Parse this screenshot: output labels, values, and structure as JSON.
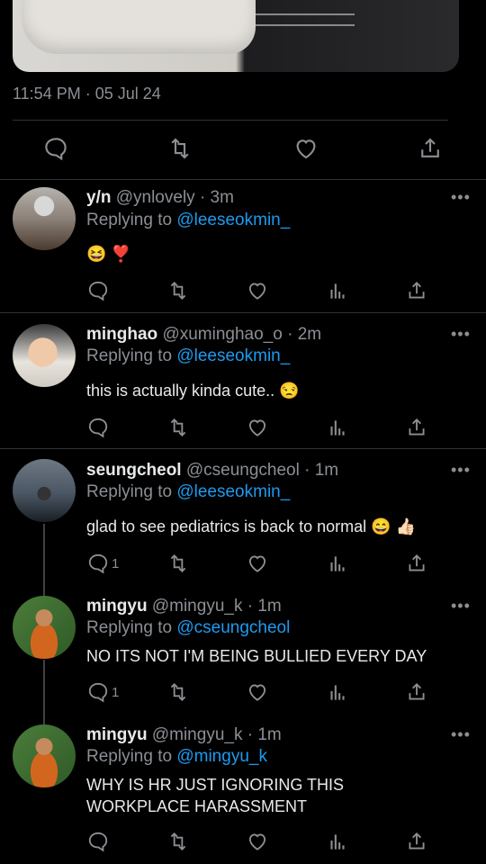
{
  "timestamp": "11:54 PM · 05 Jul 24",
  "colors": {
    "background": "#000000",
    "text": "#e7e9ea",
    "muted": "#8b8f94",
    "link": "#1d9bf0",
    "divider": "#2f3336"
  },
  "main_actions": [
    "reply-icon",
    "retweet-icon",
    "like-icon",
    "share-icon"
  ],
  "replies": [
    {
      "name": "y/n",
      "handle": "@ynlovely",
      "time": "· 3m",
      "replying_prefix": "Replying to",
      "replying_to": "@leeseokmin_",
      "text": "😆 ❣️",
      "reply_count": ""
    },
    {
      "name": "minghao",
      "handle": "@xuminghao_o",
      "time": "· 2m",
      "replying_prefix": "Replying to",
      "replying_to": "@leeseokmin_",
      "text": "this is actually kinda cute.. 😒",
      "reply_count": ""
    },
    {
      "name": "seungcheol",
      "handle": "@cseungcheol",
      "time": "· 1m",
      "replying_prefix": "Replying to",
      "replying_to": "@leeseokmin_",
      "text": "glad to see pediatrics is back to normal 😄 👍🏻",
      "reply_count": "1"
    },
    {
      "name": "mingyu",
      "handle": "@mingyu_k",
      "time": "· 1m",
      "replying_prefix": "Replying to",
      "replying_to": "@cseungcheol",
      "text": "NO ITS NOT I'M BEING BULLIED EVERY DAY",
      "reply_count": "1"
    },
    {
      "name": "mingyu",
      "handle": "@mingyu_k",
      "time": "· 1m",
      "replying_prefix": "Replying to",
      "replying_to": "@mingyu_k",
      "text": "WHY IS HR JUST IGNORING THIS WORKPLACE HARASSMENT",
      "reply_count": ""
    }
  ],
  "more_glyph": "•••"
}
